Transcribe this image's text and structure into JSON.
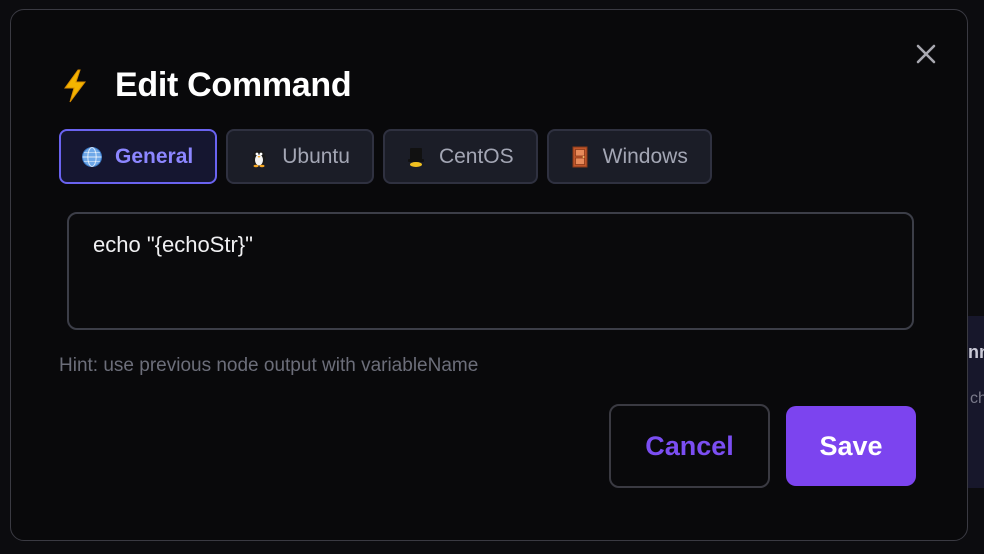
{
  "modal": {
    "title": "Edit Command",
    "title_icon": "lightning-bolt-icon",
    "close_icon": "close-icon"
  },
  "tabs": [
    {
      "label": "General",
      "icon": "globe-icon",
      "active": true
    },
    {
      "label": "Ubuntu",
      "icon": "penguin-icon",
      "active": false
    },
    {
      "label": "CentOS",
      "icon": "centos-icon",
      "active": false
    },
    {
      "label": "Windows",
      "icon": "windows-door-icon",
      "active": false
    }
  ],
  "command": {
    "value": "echo \"{echoStr}\""
  },
  "hint": "Hint: use previous node output with variableName",
  "buttons": {
    "cancel_label": "Cancel",
    "save_label": "Save"
  },
  "colors": {
    "accent": "#7c44ef",
    "tab_active": "#8c86ff",
    "background": "#09090b"
  }
}
